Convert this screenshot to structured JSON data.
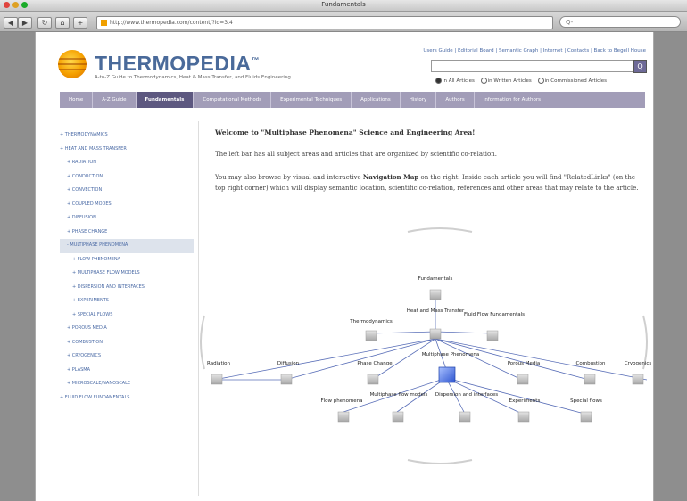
{
  "browser": {
    "title": "Fundamentals",
    "url": "http://www.thermopedia.com/content/?id=3.4",
    "search_placeholder": "Q-"
  },
  "header": {
    "logo_name": "THERMOPEDIA",
    "logo_tm": "™",
    "tagline": "A-to-Z Guide to Thermodynamics, Heat & Mass Transfer, and Fluids Engineering",
    "links": "Users Guide | Editorial Board | Semantic Graph | Internet | Contacts | Back to Begell House",
    "search_button": "Q",
    "search_options": [
      "in All Articles",
      "in Written Articles",
      "in Commissioned Articles"
    ]
  },
  "nav": {
    "items": [
      "Home",
      "A-Z Guide",
      "Fundamentals",
      "Computational Methods",
      "Experimental Techniques",
      "Applications",
      "History",
      "Authors",
      "Information for Authors"
    ]
  },
  "sidebar": {
    "items": [
      "+ THERMODYNAMICS",
      "+ HEAT AND MASS TRANSFER",
      "+ RADIATION",
      "+ CONDUCTION",
      "+ CONVECTION",
      "+ COUPLED MODES",
      "+ DIFFUSION",
      "+ PHASE CHANGE",
      "- MULTIPHASE PHENOMENA",
      "+ FLOW PHENOMENA",
      "+ MULTIPHASE FLOW MODELS",
      "+ DISPERSION AND INTERFACES",
      "+ EXPERIMENTS",
      "+ SPECIAL FLOWS",
      "+ POROUS MEDIA",
      "+ COMBUSTION",
      "+ CRYOGENICS",
      "+ PLASMA",
      "+ MICROSCALE/NANOSCALE",
      "+ FLUID FLOW FUNDAMENTALS"
    ]
  },
  "content": {
    "welcome": "Welcome to \"Multiphase Phenomena\" Science and Engineering Area!",
    "para1": "The left bar has all subject areas and articles that are organized by scientific co-relation.",
    "para2_a": "You may also browse by visual and interactive ",
    "para2_b": "Navigation Map",
    "para2_c": " on the right. Inside each article you will find \"RelatedLinks\" (on the top right corner) which will display semantic location, scientific co-relation, references and other areas that may relate to the article."
  },
  "map": {
    "nodes": {
      "fundamentals": "Fundamentals",
      "thermodynamics": "Thermodynamics",
      "heat_mass": "Heat and Mass Transfer",
      "fluid_flow": "Fluid Flow Fundamentals",
      "multiphase": "Multiphase Phenomena",
      "phase_change": "Phase Change",
      "diffusion": "Diffusion",
      "radiation": "Radiation",
      "porous": "Porous Media",
      "combustion": "Combustion",
      "cryogenics": "Cryogenics",
      "flow_phen": "Flow phenomena",
      "mpf_models": "Multiphase flow models",
      "dispersion": "Dispersion and interfaces",
      "experiments": "Experiments",
      "special_flows": "Special flows"
    }
  }
}
